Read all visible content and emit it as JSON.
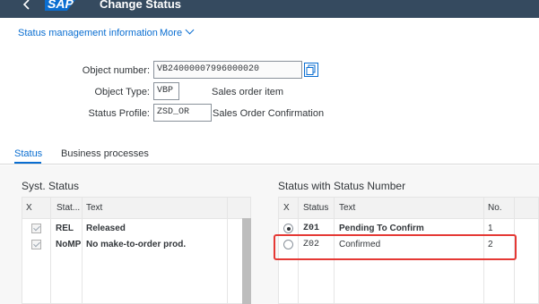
{
  "shell": {
    "logo": "SAP",
    "title": "Change Status"
  },
  "toolbar": {
    "status_info": "Status management information",
    "more": "More"
  },
  "fields": {
    "object_number_label": "Object number:",
    "object_number_value": "VB24000007996000020",
    "object_type_label": "Object Type:",
    "object_type_value": "VBP",
    "object_type_desc": "Sales order item",
    "status_profile_label": "Status Profile:",
    "status_profile_value": "ZSD_OR",
    "status_profile_desc": "Sales Order Confirmation"
  },
  "tabs": [
    {
      "label": "Status",
      "active": true
    },
    {
      "label": "Business processes",
      "active": false
    }
  ],
  "syst_status": {
    "title": "Syst. Status",
    "headers": [
      "X",
      "Stat...",
      "Text"
    ],
    "rows": [
      {
        "checked": true,
        "status": "REL",
        "text": "Released"
      },
      {
        "checked": true,
        "status": "NoMP",
        "text": "No make-to-order prod."
      }
    ]
  },
  "status_number": {
    "title": "Status with Status Number",
    "headers": [
      "X",
      "Status",
      "Text",
      "No."
    ],
    "rows": [
      {
        "selected": true,
        "status": "Z01",
        "text": "Pending To Confirm",
        "no": "1"
      },
      {
        "selected": false,
        "status": "Z02",
        "text": "Confirmed",
        "no": "2"
      }
    ]
  },
  "colors": {
    "shell": "#354a5f",
    "accent": "#0a6ed1",
    "highlight": "#e53935"
  },
  "icons": [
    "back-arrow-icon",
    "chevron-down-icon",
    "copy-icon"
  ]
}
